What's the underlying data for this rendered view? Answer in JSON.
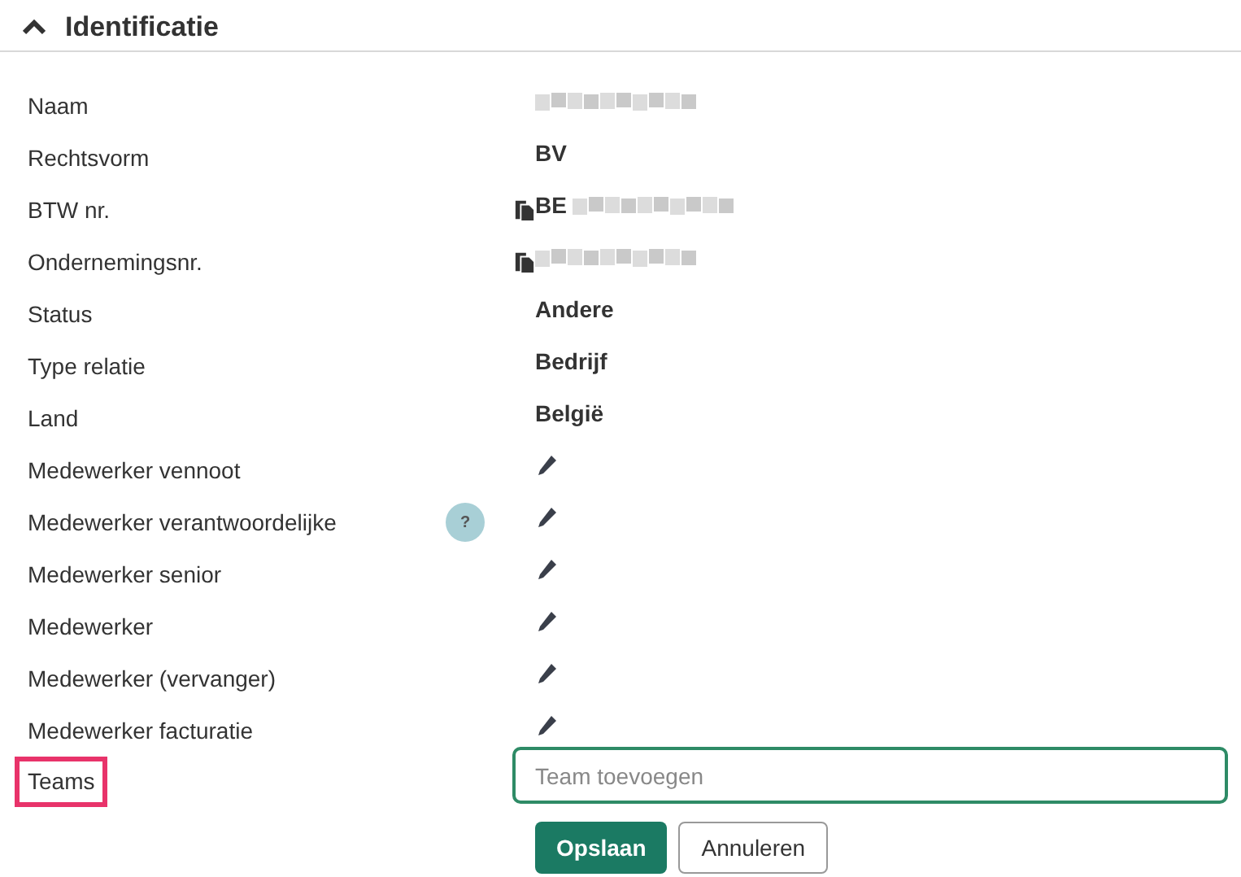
{
  "section": {
    "title": "Identificatie",
    "expanded": true
  },
  "rows": [
    {
      "kind": "value",
      "label": "Naam",
      "redacted": true
    },
    {
      "kind": "value",
      "label": "Rechtsvorm",
      "value": "BV"
    },
    {
      "kind": "value",
      "label": "BTW nr.",
      "value": "BE",
      "redacted": true,
      "copy": true
    },
    {
      "kind": "value",
      "label": "Ondernemingsnr.",
      "redacted": true,
      "copy": true
    },
    {
      "kind": "value",
      "label": "Status",
      "value": "Andere"
    },
    {
      "kind": "value",
      "label": "Type relatie",
      "value": "Bedrijf"
    },
    {
      "kind": "value",
      "label": "Land",
      "value": "België"
    },
    {
      "kind": "edit",
      "label": "Medewerker vennoot"
    },
    {
      "kind": "edit",
      "label": "Medewerker verantwoordelijke",
      "help": "?"
    },
    {
      "kind": "edit",
      "label": "Medewerker senior"
    },
    {
      "kind": "edit",
      "label": "Medewerker"
    },
    {
      "kind": "edit",
      "label": "Medewerker (vervanger)"
    },
    {
      "kind": "edit",
      "label": "Medewerker facturatie"
    },
    {
      "kind": "input",
      "label": "Teams",
      "highlighted": true,
      "placeholder": "Team toevoegen"
    }
  ],
  "buttons": [
    {
      "label": "Opslaan",
      "kind": "primary"
    },
    {
      "label": "Annuleren",
      "kind": "secondary"
    }
  ]
}
